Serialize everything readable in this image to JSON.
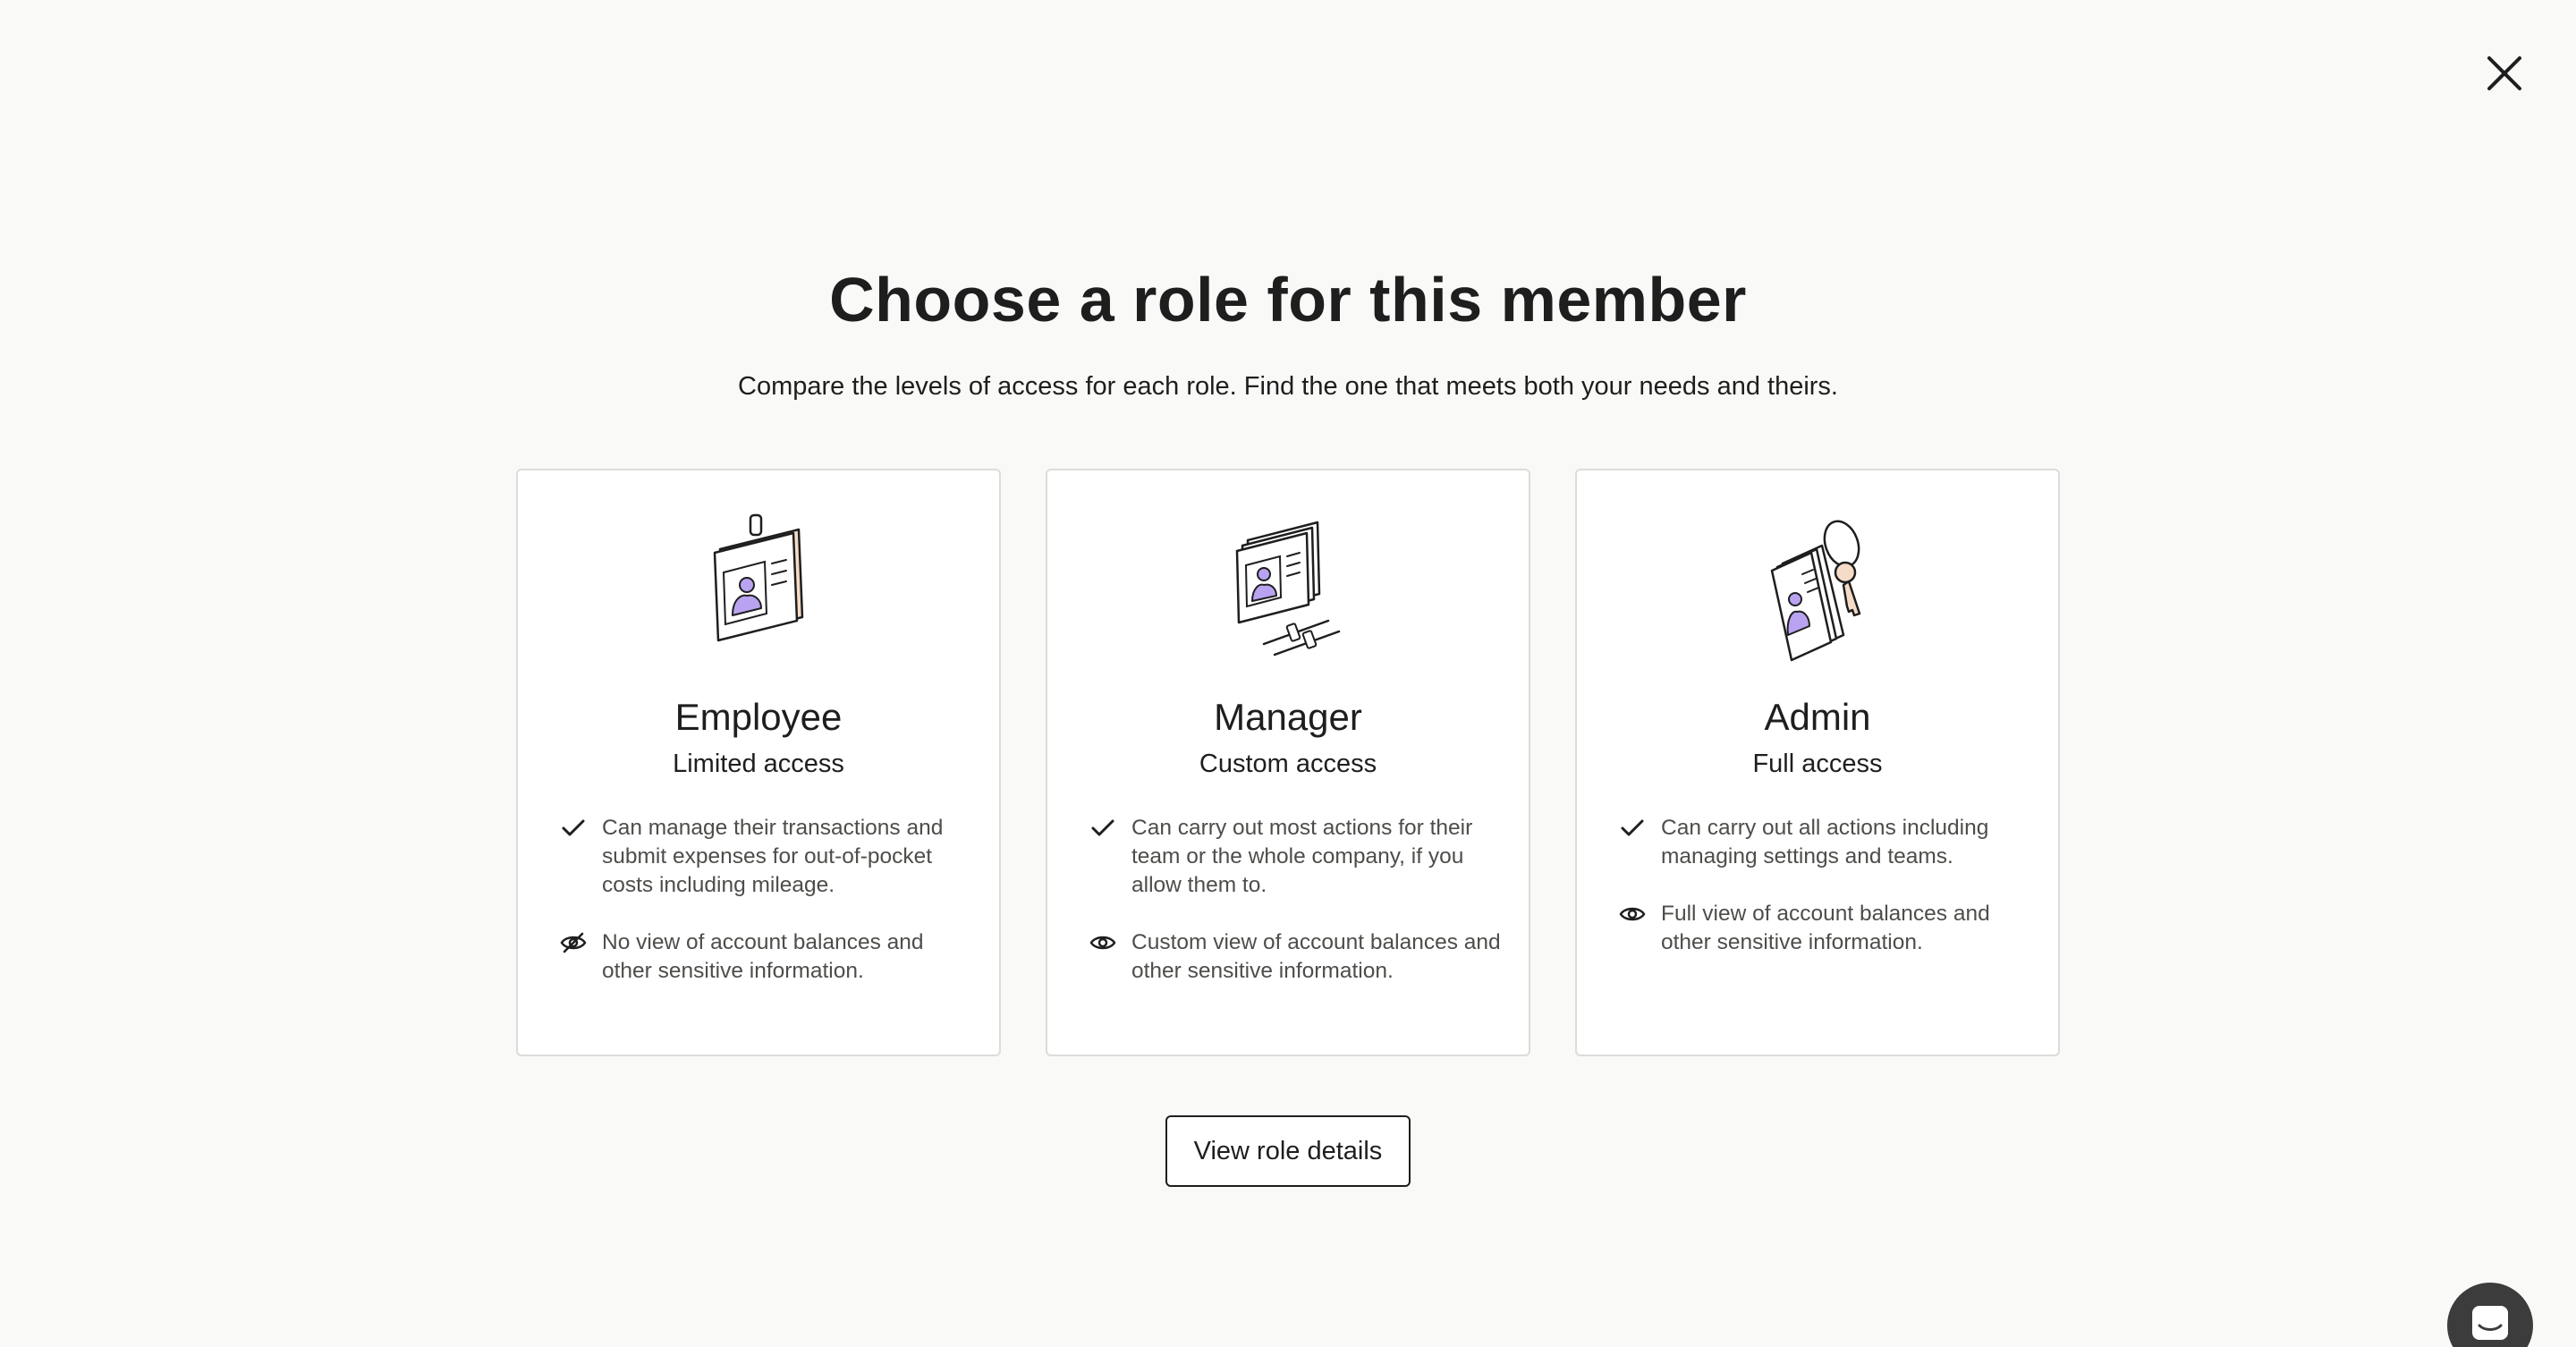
{
  "modal": {
    "title": "Choose a role for this member",
    "subtitle": "Compare the levels of access for each role. Find the one that meets both your needs and theirs.",
    "view_details_label": "View role details"
  },
  "roles": [
    {
      "name": "Employee",
      "access": "Limited access",
      "illustration": "id-badge-icon",
      "features": [
        {
          "icon": "check-icon",
          "text": "Can manage their transactions and submit expenses for out-of-pocket costs including mileage."
        },
        {
          "icon": "eye-off-icon",
          "text": "No view of account balances and other sensitive information."
        }
      ]
    },
    {
      "name": "Manager",
      "access": "Custom access",
      "illustration": "cards-with-sliders-icon",
      "features": [
        {
          "icon": "check-icon",
          "text": "Can carry out most actions for their team or the whole company, if you allow them to."
        },
        {
          "icon": "eye-icon",
          "text": "Custom view of account balances and other sensitive information."
        }
      ]
    },
    {
      "name": "Admin",
      "access": "Full access",
      "illustration": "cards-with-key-ring-icon",
      "features": [
        {
          "icon": "check-icon",
          "text": "Can carry out all actions including managing settings and teams."
        },
        {
          "icon": "eye-icon",
          "text": "Full view of account balances and other sensitive information."
        }
      ]
    }
  ],
  "icons": {
    "close": "close-icon",
    "chat": "chat-icon"
  },
  "colors": {
    "background": "#f9f9f7",
    "card": "#ffffff",
    "card_border": "#dcdcd8",
    "text": "#1e1e1e",
    "muted_text": "#4d4d4a",
    "illustration_accent": "#b9a3f0",
    "illustration_skin": "#f5dcc8",
    "chat_launcher": "#3c3c3c"
  }
}
